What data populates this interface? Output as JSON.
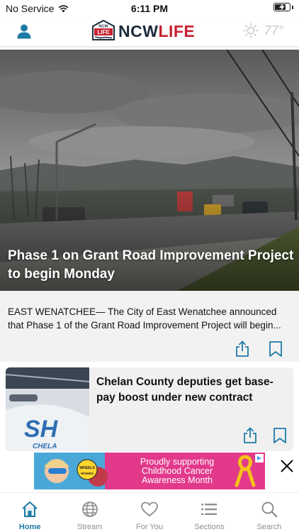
{
  "status_bar": {
    "carrier": "No Service",
    "time": "6:11 PM",
    "battery_level": 0.8
  },
  "header": {
    "logo_badge_top": "NCW",
    "logo_badge_mid": "LIFE",
    "logo_ncw": "NCW",
    "logo_life": "LIFE",
    "temperature": "77°",
    "weather_icon": "sun-icon"
  },
  "hero": {
    "title": "Phase 1 on Grant Road Improvement Project to begin Monday",
    "summary": "EAST WENATCHEE— The City of East Wenatchee announced that Phase 1 of the Grant Road Improvement Project will begin..."
  },
  "articles": [
    {
      "title": "Chelan County deputies get base-pay boost under new contract",
      "thumb_text_1": "SH",
      "thumb_text_2": "CHELA"
    }
  ],
  "ad": {
    "line1": "Proudly supporting",
    "line2": "Childhood Cancer",
    "line3": "Awareness Month",
    "badge_top": "WHEELS",
    "badge_bottom": "WISHES"
  },
  "tabs": [
    {
      "label": "Home",
      "icon": "home-icon",
      "active": true
    },
    {
      "label": "Stream",
      "icon": "globe-icon",
      "active": false
    },
    {
      "label": "For You",
      "icon": "heart-icon",
      "active": false
    },
    {
      "label": "Sections",
      "icon": "list-icon",
      "active": false
    },
    {
      "label": "Search",
      "icon": "search-icon",
      "active": false
    }
  ],
  "colors": {
    "accent": "#1e7ba6",
    "brand_red": "#c8202f",
    "brand_navy": "#1b2b3c",
    "ad_pink": "#e2398b"
  }
}
